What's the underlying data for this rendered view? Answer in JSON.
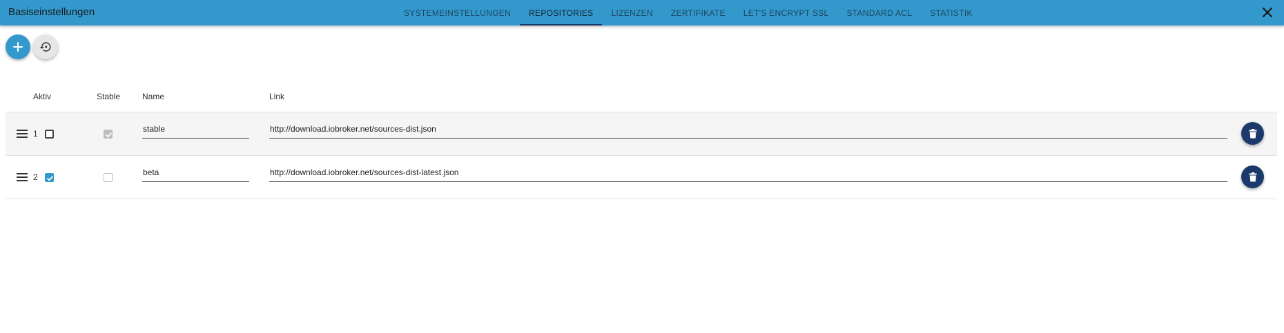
{
  "header": {
    "title": "Basiseinstellungen",
    "tabs": [
      {
        "label": "SYSTEMEINSTELLUNGEN",
        "active": false
      },
      {
        "label": "REPOSITORIES",
        "active": true
      },
      {
        "label": "LIZENZEN",
        "active": false
      },
      {
        "label": "ZERTIFIKATE",
        "active": false
      },
      {
        "label": "LET'S ENCRYPT SSL",
        "active": false
      },
      {
        "label": "STANDARD ACL",
        "active": false
      },
      {
        "label": "STATISTIK",
        "active": false
      }
    ],
    "close_icon": "close-icon"
  },
  "toolbar": {
    "add_icon": "plus-icon",
    "restore_icon": "restore-icon"
  },
  "table": {
    "headers": {
      "active": "Aktiv",
      "stable": "Stable",
      "name": "Name",
      "link": "Link"
    },
    "rows": [
      {
        "index": "1",
        "active": false,
        "stable": true,
        "stable_disabled": true,
        "name": "stable",
        "link": "http://download.iobroker.net/sources-dist.json"
      },
      {
        "index": "2",
        "active": true,
        "stable": false,
        "stable_disabled": false,
        "name": "beta",
        "link": "http://download.iobroker.net/sources-dist-latest.json"
      }
    ]
  },
  "colors": {
    "primary": "#3399cc",
    "secondary": "#1b3a6b",
    "row_shade": "#f5f5f5"
  }
}
